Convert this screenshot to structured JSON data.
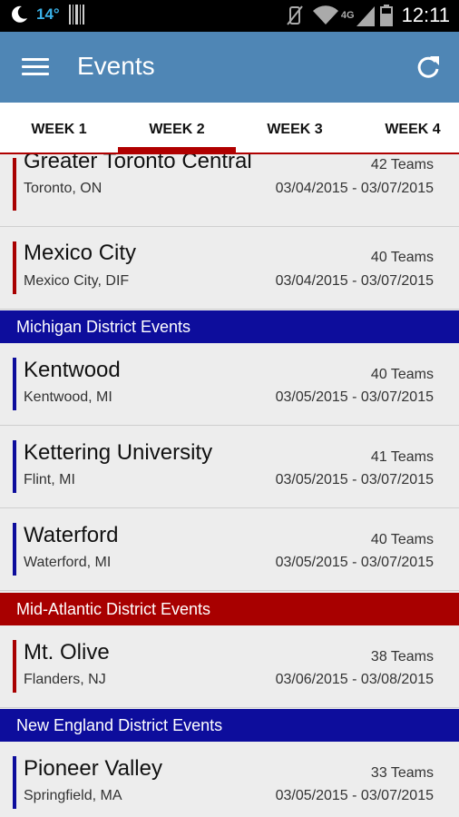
{
  "status_bar": {
    "temperature": "14°",
    "time": "12:11",
    "network": "4G"
  },
  "app_bar": {
    "title": "Events"
  },
  "tabs": [
    {
      "label": "WEEK 1",
      "active": false
    },
    {
      "label": "WEEK 2",
      "active": true
    },
    {
      "label": "WEEK 3",
      "active": false
    },
    {
      "label": "WEEK 4",
      "active": false
    }
  ],
  "colors": {
    "app_bar": "#4f86b5",
    "accent_red": "#b00000",
    "michigan_blue": "#0d0d9c",
    "mid_atlantic_red": "#a80000",
    "new_england_blue": "#0d0d9c"
  },
  "list": {
    "events_top": [
      {
        "name": "Greater Toronto Central",
        "location": "Toronto, ON",
        "teams": "42 Teams",
        "dates": "03/04/2015 - 03/07/2015"
      },
      {
        "name": "Mexico City",
        "location": "Mexico City, DIF",
        "teams": "40 Teams",
        "dates": "03/04/2015 - 03/07/2015"
      }
    ],
    "michigan_header": "Michigan District Events",
    "michigan_events": [
      {
        "name": "Kentwood",
        "location": "Kentwood, MI",
        "teams": "40 Teams",
        "dates": "03/05/2015 - 03/07/2015"
      },
      {
        "name": "Kettering University",
        "location": "Flint, MI",
        "teams": "41 Teams",
        "dates": "03/05/2015 - 03/07/2015"
      },
      {
        "name": "Waterford",
        "location": "Waterford, MI",
        "teams": "40 Teams",
        "dates": "03/05/2015 - 03/07/2015"
      }
    ],
    "mid_atlantic_header": "Mid-Atlantic District Events",
    "mid_atlantic_events": [
      {
        "name": "Mt. Olive",
        "location": "Flanders, NJ",
        "teams": "38 Teams",
        "dates": "03/06/2015 - 03/08/2015"
      }
    ],
    "new_england_header": "New England District Events",
    "new_england_events": [
      {
        "name": "Pioneer Valley",
        "location": "Springfield, MA",
        "teams": "33 Teams",
        "dates": "03/05/2015 - 03/07/2015"
      }
    ]
  }
}
